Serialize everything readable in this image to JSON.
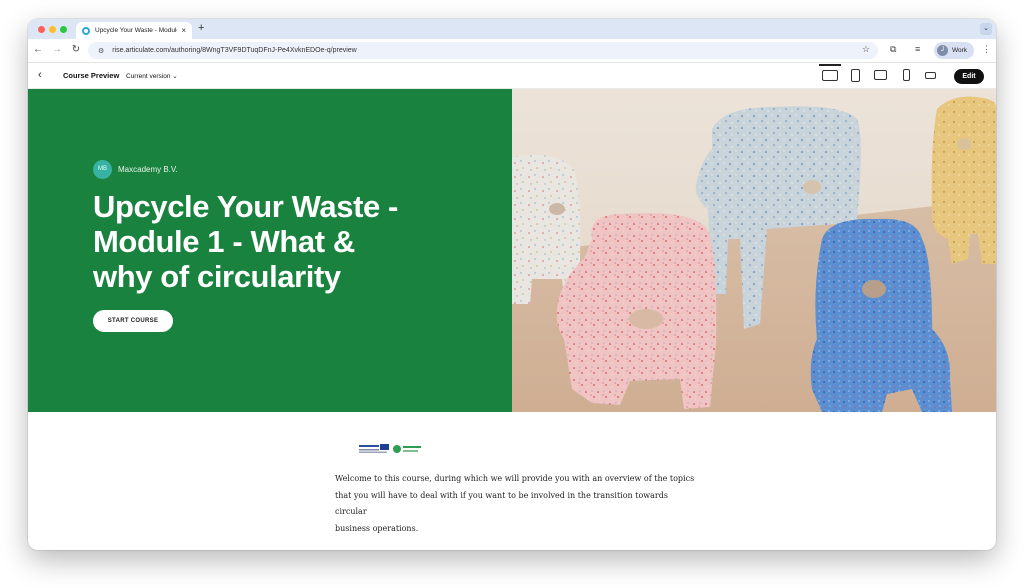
{
  "browser": {
    "tab_title": "Upcycle Your Waste - Module",
    "tab_close": "×",
    "new_tab": "+",
    "url": "rise.articulate.com/authoring/8WngT3VF9DTuqDFnJ-Pe4XvknEDOe-q/preview",
    "profile_label": "Work",
    "profile_initial": "J"
  },
  "header": {
    "title": "Course Preview",
    "version_label": "Current version"
  },
  "hero": {
    "author_initials": "MB",
    "author_name": "Maxcademy B.V.",
    "title": "Upcycle Your Waste - Module 1 - What & why of circularity",
    "start_button": "START COURSE",
    "background_color": "#1a823f"
  },
  "edit_button": "Edit",
  "body": {
    "logo_left_text": "Interreg",
    "logo_right_text": "Upcycle your waste",
    "intro_lines": [
      "Welcome to this course, during which we will provide you with an overview of the topics",
      "that you will have to deal with if you want to be involved in the transition towards",
      "circular",
      "business operations."
    ]
  },
  "icons": {
    "back": "arrow-left-icon",
    "forward": "arrow-right-icon",
    "reload": "reload-icon",
    "site_settings": "tune-icon",
    "bookmark": "star-icon",
    "extensions": "puzzle-icon",
    "media": "media-icon",
    "menu": "kebab-icon",
    "devices": [
      "desktop-icon",
      "tablet-portrait-icon",
      "tablet-landscape-icon",
      "phone-portrait-icon",
      "phone-landscape-icon"
    ]
  }
}
